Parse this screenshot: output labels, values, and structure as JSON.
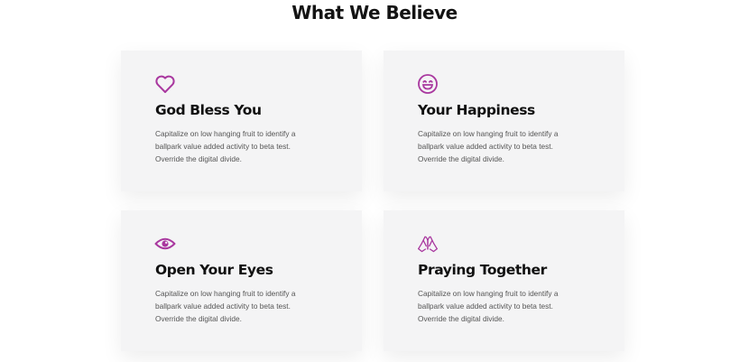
{
  "section": {
    "title": "What We Believe"
  },
  "accent_color": "#a9389f",
  "cards": [
    {
      "icon": "heart-icon",
      "title": "God Bless You",
      "description": [
        "Capitalize on low hanging fruit to identify a",
        "ballpark value added activity to beta test.",
        "Override the digital divide."
      ]
    },
    {
      "icon": "smile-icon",
      "title": "Your Happiness",
      "description": [
        "Capitalize on low hanging fruit to identify a",
        "ballpark value added activity to beta test.",
        "Override the digital divide."
      ]
    },
    {
      "icon": "eye-icon",
      "title": "Open Your Eyes",
      "description": [
        "Capitalize on low hanging fruit to identify a",
        "ballpark value added activity to beta test.",
        "Override the digital divide."
      ]
    },
    {
      "icon": "praying-hands-icon",
      "title": "Praying Together",
      "description": [
        "Capitalize on low hanging fruit to identify a",
        "ballpark value added activity to beta test.",
        "Override the digital divide."
      ]
    }
  ]
}
